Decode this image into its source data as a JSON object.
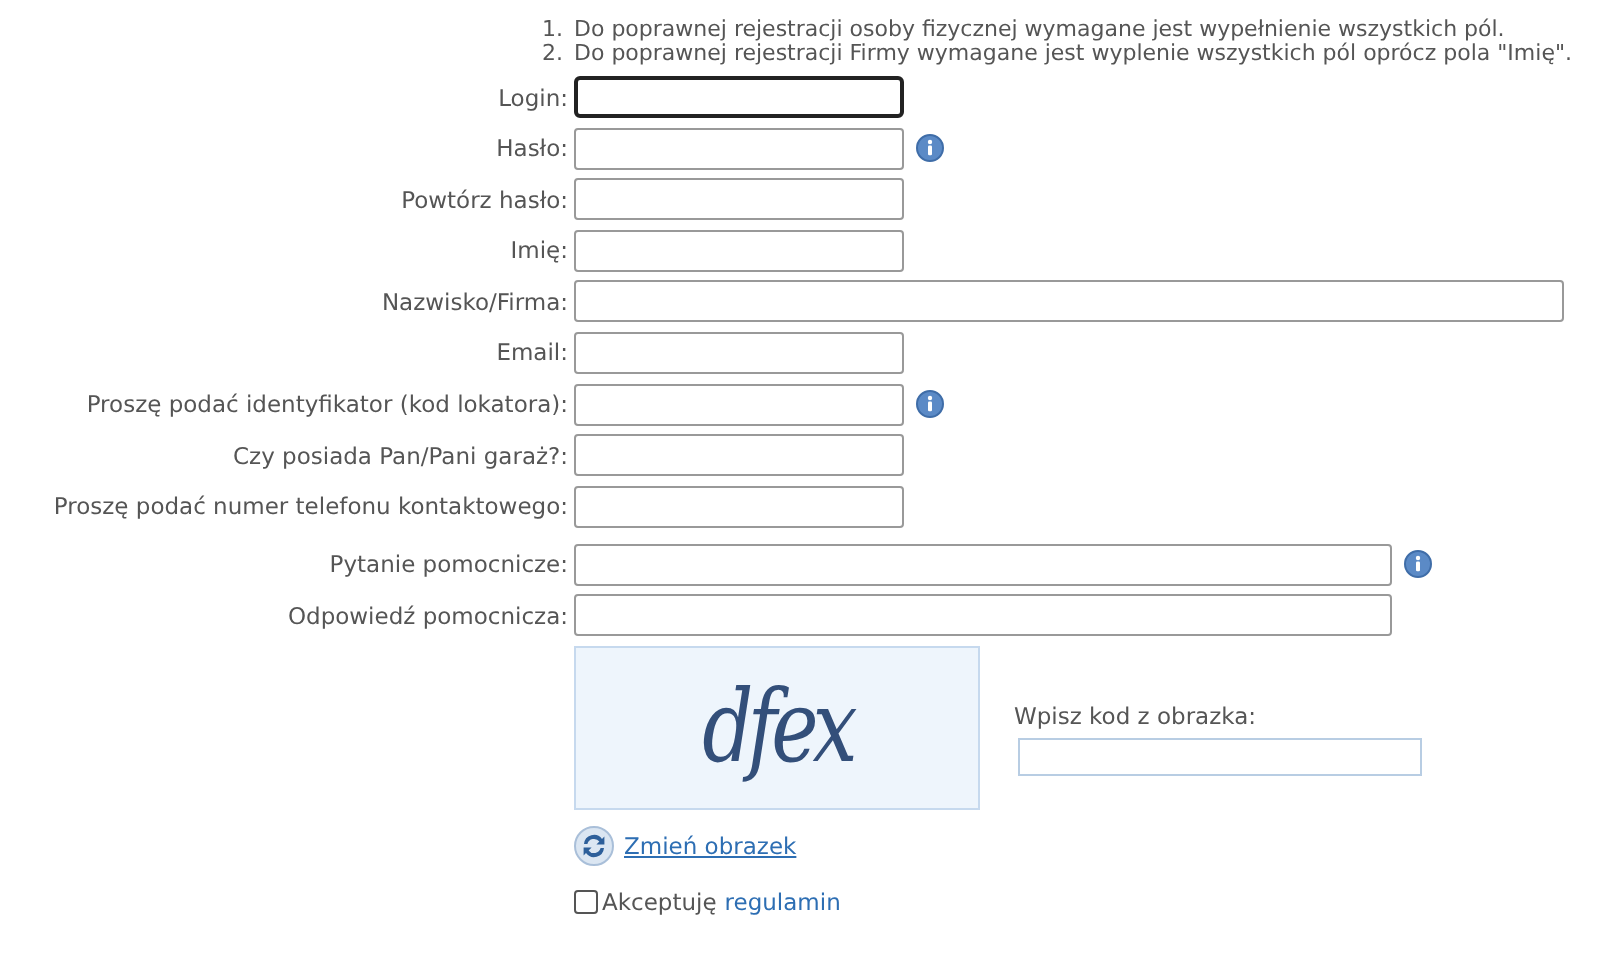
{
  "notes": [
    {
      "number": "1.",
      "text": "Do poprawnej rejestracji osoby fizycznej wymagane jest wypełnienie wszystkich pól."
    },
    {
      "number": "2.",
      "text": "Do poprawnej rejestracji Firmy wymagane jest wyplenie wszystkich pól oprócz pola \"Imię\"."
    }
  ],
  "fields": [
    {
      "label": "Login:",
      "kind": "short",
      "focused": true,
      "info": false
    },
    {
      "label": "Hasło:",
      "kind": "short",
      "focused": false,
      "info": true
    },
    {
      "label": "Powtórz hasło:",
      "kind": "short",
      "focused": false,
      "info": false
    },
    {
      "label": "Imię:",
      "kind": "short",
      "focused": false,
      "info": false
    },
    {
      "label": "Nazwisko/Firma:",
      "kind": "wide",
      "focused": false,
      "info": false
    },
    {
      "label": "Email:",
      "kind": "short",
      "focused": false,
      "info": false
    },
    {
      "label": "Proszę podać identyfikator (kod lokatora):",
      "kind": "short",
      "focused": false,
      "info": true
    },
    {
      "label": "Czy posiada Pan/Pani garaż?:",
      "kind": "short",
      "focused": false,
      "info": false
    },
    {
      "label": "Proszę podać numer telefonu kontaktowego:",
      "kind": "short",
      "focused": false,
      "info": false
    }
  ],
  "help_fields": [
    {
      "label": "Pytanie pomocnicze:",
      "kind": "medium",
      "focused": false,
      "info": true
    },
    {
      "label": "Odpowiedź pomocnicza:",
      "kind": "medium",
      "focused": false,
      "info": false
    }
  ],
  "captcha": {
    "code": "dfex",
    "prompt": "Wpisz kod z obrazka:",
    "refresh_link": "Zmień obrazek"
  },
  "terms": {
    "checked": false,
    "label": "Akceptuję",
    "link": "regulamin"
  }
}
